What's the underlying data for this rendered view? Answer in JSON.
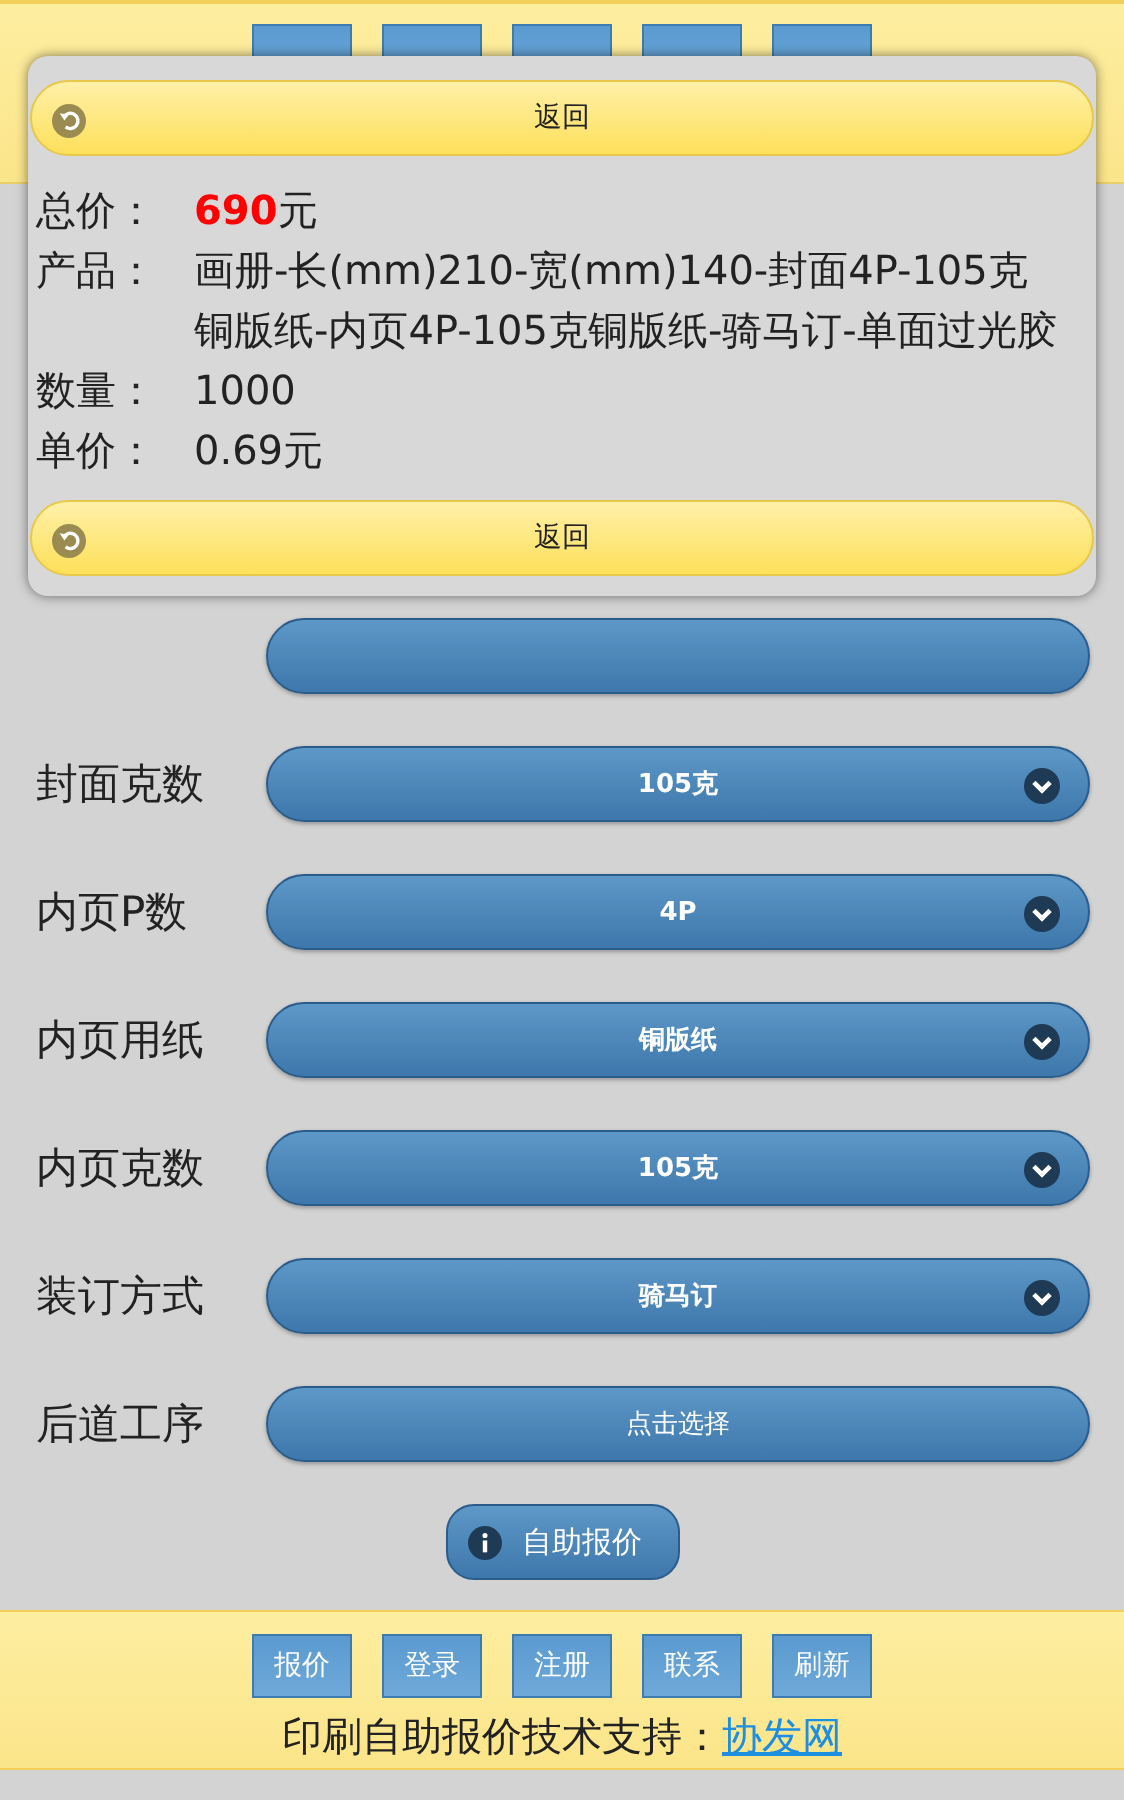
{
  "form": {
    "rows": [
      {
        "label": "封面克数",
        "value": "105克",
        "kind": "select"
      },
      {
        "label": "内页P数",
        "value": "4P",
        "kind": "select"
      },
      {
        "label": "内页用纸",
        "value": "铜版纸",
        "kind": "select"
      },
      {
        "label": "内页克数",
        "value": "105克",
        "kind": "select"
      },
      {
        "label": "装订方式",
        "value": "骑马订",
        "kind": "select"
      },
      {
        "label": "后道工序",
        "value": "点击选择",
        "kind": "button"
      }
    ],
    "submit": "自助报价"
  },
  "popup": {
    "back_top": "返回",
    "total": {
      "label": "总价：",
      "amount": "690",
      "unit": "元"
    },
    "details": [
      {
        "label": "产品：",
        "value": "画册-长(mm)210-宽(mm)140-封面4P-105克铜版纸-内页4P-105克铜版纸-骑马订-单面过光胶"
      },
      {
        "label": "数量：",
        "value": "1000"
      },
      {
        "label": "单价：",
        "value": "0.69元"
      }
    ],
    "back_bottom": "返回"
  },
  "footer": {
    "nav": [
      "报价",
      "登录",
      "注册",
      "联系",
      "刷新"
    ],
    "credit": "印刷自助报价技术支持：",
    "link": "协发网"
  }
}
